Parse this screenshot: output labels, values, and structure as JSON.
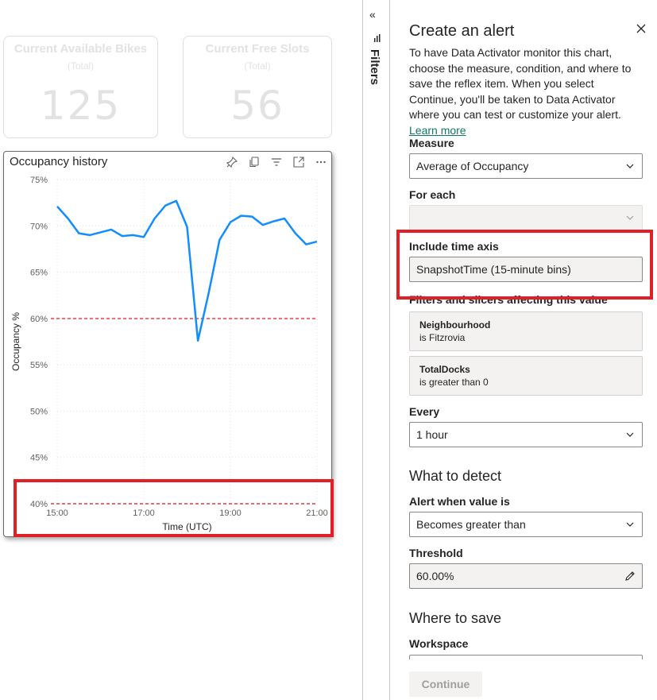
{
  "report": {
    "cards": [
      {
        "title": "Current Available Bikes",
        "subtitle": "(Total)",
        "value": "125"
      },
      {
        "title": "Current Free Slots",
        "subtitle": "(Total)",
        "value": "56"
      }
    ],
    "visual": {
      "title": "Occupancy history",
      "tools": [
        "pin-icon",
        "copy-icon",
        "filter-icon",
        "focus-mode-icon",
        "more-options-icon"
      ]
    }
  },
  "chart_data": {
    "type": "line",
    "title": "Occupancy history",
    "xlabel": "Time (UTC)",
    "ylabel": "Occupancy %",
    "x_ticks": [
      "15:00",
      "17:00",
      "19:00",
      "21:00"
    ],
    "y_ticks": [
      "40%",
      "45%",
      "50%",
      "55%",
      "60%",
      "65%",
      "70%",
      "75%"
    ],
    "ylim": [
      40,
      75
    ],
    "xlim": [
      "15:00",
      "21:00"
    ],
    "grid": true,
    "series": [
      {
        "color": "#118dff",
        "x": [
          "15:00",
          "15:15",
          "15:30",
          "15:45",
          "16:00",
          "16:15",
          "16:30",
          "16:45",
          "17:00",
          "17:15",
          "17:30",
          "17:45",
          "18:00",
          "18:15",
          "18:30",
          "18:45",
          "19:00",
          "19:15",
          "19:30",
          "19:45",
          "20:00",
          "20:15",
          "20:30",
          "20:45",
          "21:00"
        ],
        "values": [
          72.1,
          70.8,
          69.2,
          69.0,
          69.3,
          69.6,
          68.9,
          69.0,
          68.8,
          70.8,
          72.2,
          72.7,
          69.9,
          57.6,
          62.8,
          68.5,
          70.4,
          71.1,
          71.0,
          70.1,
          70.5,
          70.8,
          69.2,
          68.0,
          68.3
        ]
      }
    ],
    "reference_lines": [
      {
        "value": 60,
        "color": "#e86a72",
        "style": "dashed"
      },
      {
        "value": 40,
        "color": "#e86a72",
        "style": "dashed"
      }
    ]
  },
  "filters_pane": {
    "label": "Filters"
  },
  "alert_panel": {
    "title": "Create an alert",
    "description": "To have Data Activator monitor this chart, choose the measure, condition, and where to save the reflex item. When you select Continue, you'll be taken to Data Activator where you can test or customize your alert.",
    "learn_more": "Learn more",
    "measure_label": "Measure",
    "measure_value": "Average of Occupancy",
    "for_each_label": "For each",
    "for_each_value": "",
    "time_axis_label": "Include time axis",
    "time_axis_value": "SnapshotTime (15-minute bins)",
    "filters_label": "Filters and slicers affecting this value",
    "filters": [
      {
        "name": "Neighbourhood",
        "condition": "is Fitzrovia"
      },
      {
        "name": "TotalDocks",
        "condition": "is greater than 0"
      }
    ],
    "every_label": "Every",
    "every_value": "1 hour",
    "what_to_detect": "What to detect",
    "alert_when_label": "Alert when value is",
    "alert_when_value": "Becomes greater than",
    "threshold_label": "Threshold",
    "threshold_value": "60.00%",
    "where_to_save": "Where to save",
    "workspace_label": "Workspace",
    "continue_label": "Continue"
  },
  "colors": {
    "accent": "#117865",
    "line": "#118dff",
    "highlight": "#e02027",
    "reference": "#e86a72"
  }
}
